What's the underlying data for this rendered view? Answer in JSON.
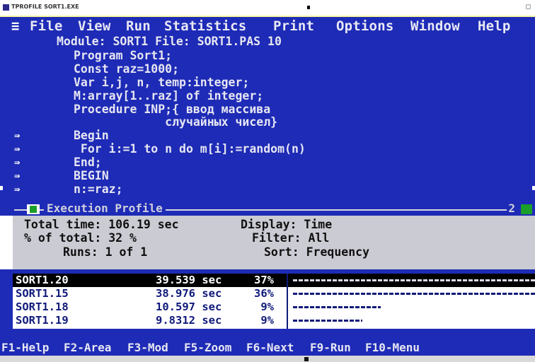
{
  "title_bar": {
    "text": "TPROFILE SORT1.EXE",
    "button": "_",
    "button2": "◻"
  },
  "menu": {
    "system": "≡",
    "items": [
      "File",
      "View",
      "Run",
      "Statistics",
      "Print",
      "Options",
      "Window",
      "Help"
    ]
  },
  "module": {
    "header": "Module: SORT1 File: SORT1.PAS 10",
    "lines": [
      "Program Sort1;",
      "Const raz=1000;",
      "Var i,j, n, temp:integer;",
      "M:array[1..raz] of integer;",
      "Procedure INP;{ ввод массива",
      "             случайных чисел}",
      "Begin",
      " For i:=1 to n do m[i]:=random(n)",
      "End;",
      "BEGIN",
      "n:=raz;"
    ],
    "arrow_symbol": "⇛"
  },
  "execution_window": {
    "title": "Execution Profile",
    "number": "2",
    "total_time": "Total time: 106.19 sec",
    "pct_total": "% of total: 32 %",
    "runs": "Runs: 1 of 1",
    "display": "Display: Time",
    "filter": "Filter: All",
    "sort": "Sort: Frequency"
  },
  "results": {
    "rows": [
      {
        "name": "SORT1.20",
        "time": "39.539 sec",
        "pct": "37%",
        "fraction": 0.37,
        "selected": true
      },
      {
        "name": "SORT1.15",
        "time": "38.976 sec",
        "pct": "36%",
        "fraction": 0.36,
        "selected": false
      },
      {
        "name": "SORT1.18",
        "time": "10.597 sec",
        "pct": "9%",
        "fraction": 0.09,
        "selected": false
      },
      {
        "name": "SORT1.19",
        "time": "9.8312 sec",
        "pct": "9%",
        "fraction": 0.09,
        "selected": false
      }
    ]
  },
  "status_bar": {
    "keys": [
      "F1-Help",
      "F2-Area",
      "F3-Mod",
      "F5-Zoom",
      "F6-Next",
      "F9-Run",
      "F10-Menu"
    ]
  },
  "colors": {
    "background": "#1e2bb6",
    "profile_panel": "#cbcbd3",
    "results_panel": "#ffffff",
    "selected_row": "#000000",
    "active_button": "#1b9e2a"
  }
}
